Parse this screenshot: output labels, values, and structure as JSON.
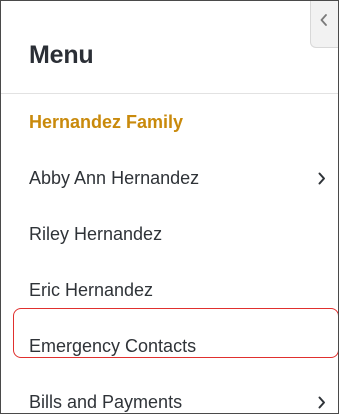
{
  "menu": {
    "title": "Menu",
    "items": [
      {
        "label": "Hernandez Family",
        "type": "family-header",
        "has_submenu": false
      },
      {
        "label": "Abby Ann Hernandez",
        "type": "member",
        "has_submenu": true
      },
      {
        "label": "Riley Hernandez",
        "type": "member",
        "has_submenu": false
      },
      {
        "label": "Eric Hernandez",
        "type": "member",
        "has_submenu": false
      },
      {
        "label": "Emergency Contacts",
        "type": "link",
        "has_submenu": false,
        "highlighted": true
      },
      {
        "label": "Bills and Payments",
        "type": "link",
        "has_submenu": true
      }
    ]
  },
  "icons": {
    "collapse": "chevron-left-icon",
    "submenu": "chevron-right-icon"
  },
  "colors": {
    "family_header": "#c98a0c",
    "text": "#2f3338",
    "highlight_border": "#e0302e"
  }
}
